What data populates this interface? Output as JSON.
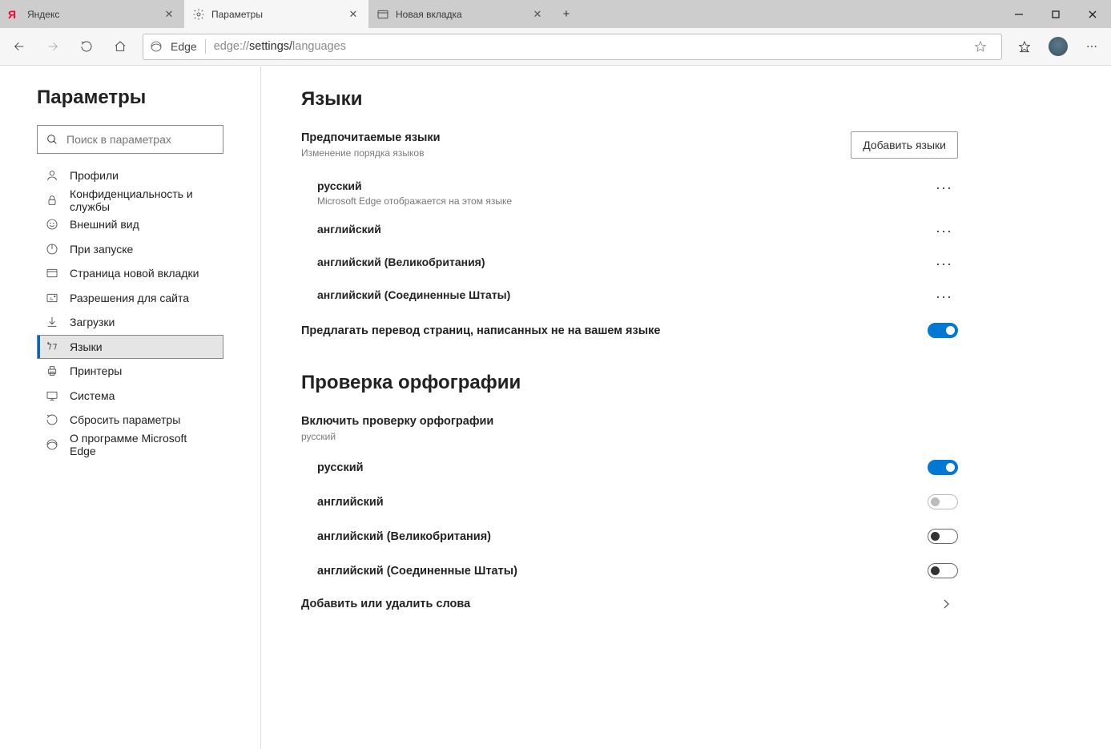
{
  "window": {
    "tabs": [
      {
        "label": "Яндекс",
        "icon": "yandex"
      },
      {
        "label": "Параметры",
        "icon": "gear",
        "active": true
      },
      {
        "label": "Новая вкладка",
        "icon": "newtab"
      }
    ]
  },
  "toolbar": {
    "edge_label": "Edge",
    "url_prefix": "edge://",
    "url_mid": "settings/",
    "url_tail": "languages"
  },
  "sidebar": {
    "title": "Параметры",
    "search_placeholder": "Поиск в параметрах",
    "items": [
      "Профили",
      "Конфиденциальность и службы",
      "Внешний вид",
      "При запуске",
      "Страница новой вкладки",
      "Разрешения для сайта",
      "Загрузки",
      "Языки",
      "Принтеры",
      "Система",
      "Сбросить параметры",
      "О программе Microsoft Edge"
    ],
    "active_index": 7
  },
  "content": {
    "languages_title": "Языки",
    "preferred_label": "Предпочитаемые языки",
    "preferred_sub": "Изменение порядка языков",
    "add_button": "Добавить языки",
    "languages": [
      {
        "name": "русский",
        "sub": "Microsoft Edge отображается на этом языке"
      },
      {
        "name": "английский"
      },
      {
        "name": "английский (Великобритания)"
      },
      {
        "name": "английский (Соединенные Штаты)"
      }
    ],
    "translate_label": "Предлагать перевод страниц, написанных не на вашем языке",
    "translate_on": true,
    "spellcheck_title": "Проверка орфографии",
    "spellcheck_enable_label": "Включить проверку орфографии",
    "spellcheck_enable_sub": "русский",
    "spellcheck_langs": [
      {
        "name": "русский",
        "state": "on"
      },
      {
        "name": "английский",
        "state": "off-disabled"
      },
      {
        "name": "английский (Великобритания)",
        "state": "off"
      },
      {
        "name": "английский (Соединенные Штаты)",
        "state": "off"
      }
    ],
    "custom_words_label": "Добавить или удалить слова"
  }
}
